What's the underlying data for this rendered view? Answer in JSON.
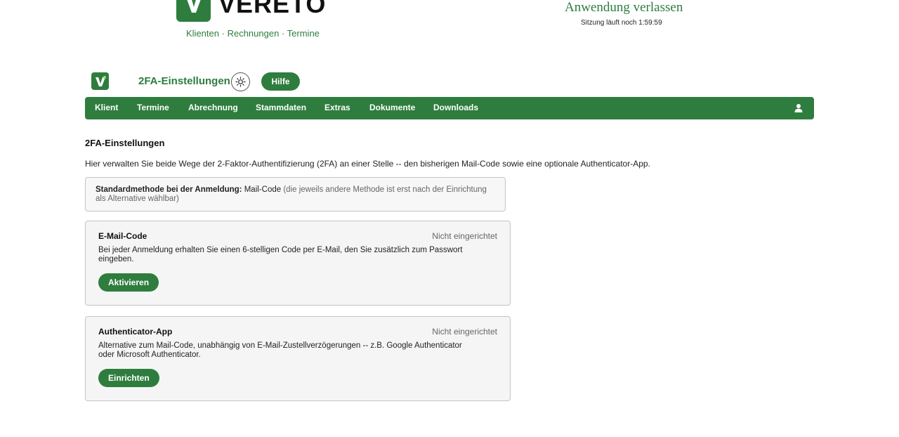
{
  "brand": {
    "name": "VERETO",
    "logo_letter": "V"
  },
  "top_links": [
    "Klienten",
    "Rechnungen",
    "Termine"
  ],
  "top_links_separator": "·",
  "session": {
    "exit_label": "Anwendung verlassen",
    "timer_text": "Sitzung läuft noch 1:59:59"
  },
  "header": {
    "title": "2FA-Einstellungen",
    "help_label": "Hilfe",
    "logo_letter": "V"
  },
  "nav": {
    "items": [
      "Klient",
      "Termine",
      "Abrechnung",
      "Stammdaten",
      "Extras",
      "Dokumente",
      "Downloads"
    ],
    "user_icon": "user-icon"
  },
  "content": {
    "heading": "2FA-Einstellungen",
    "intro": "Hier verwalten Sie beide Wege der 2-Faktor-Authentifizierung (2FA) an einer Stelle -- den bisherigen Mail-Code sowie eine optionale Authenticator-App.",
    "default_method": {
      "label": "Standardmethode bei der Anmeldung:",
      "value": "Mail-Code",
      "note": "(die jeweils andere Methode ist erst nach der Einrichtung als Alternative wählbar)"
    },
    "email": {
      "title": "E-Mail-Code",
      "status": "Nicht eingerichtet",
      "description": "Bei jeder Anmeldung erhalten Sie einen 6-stelligen Code per E-Mail, den Sie zusätzlich zum Passwort eingeben.",
      "button": "Aktivieren"
    },
    "authenticator": {
      "title": "Authenticator-App",
      "status": "Nicht eingerichtet",
      "description": "Alternative zum Mail-Code, unabhängig von E-Mail-Zustellverzögerungen -- z.B. Google Authenticator oder Microsoft Authenticator.",
      "button": "Einrichten"
    }
  },
  "colors": {
    "brand_green": "#2e7d3e",
    "panel_bg": "#f5f5f5",
    "border": "#c4c4c4"
  }
}
